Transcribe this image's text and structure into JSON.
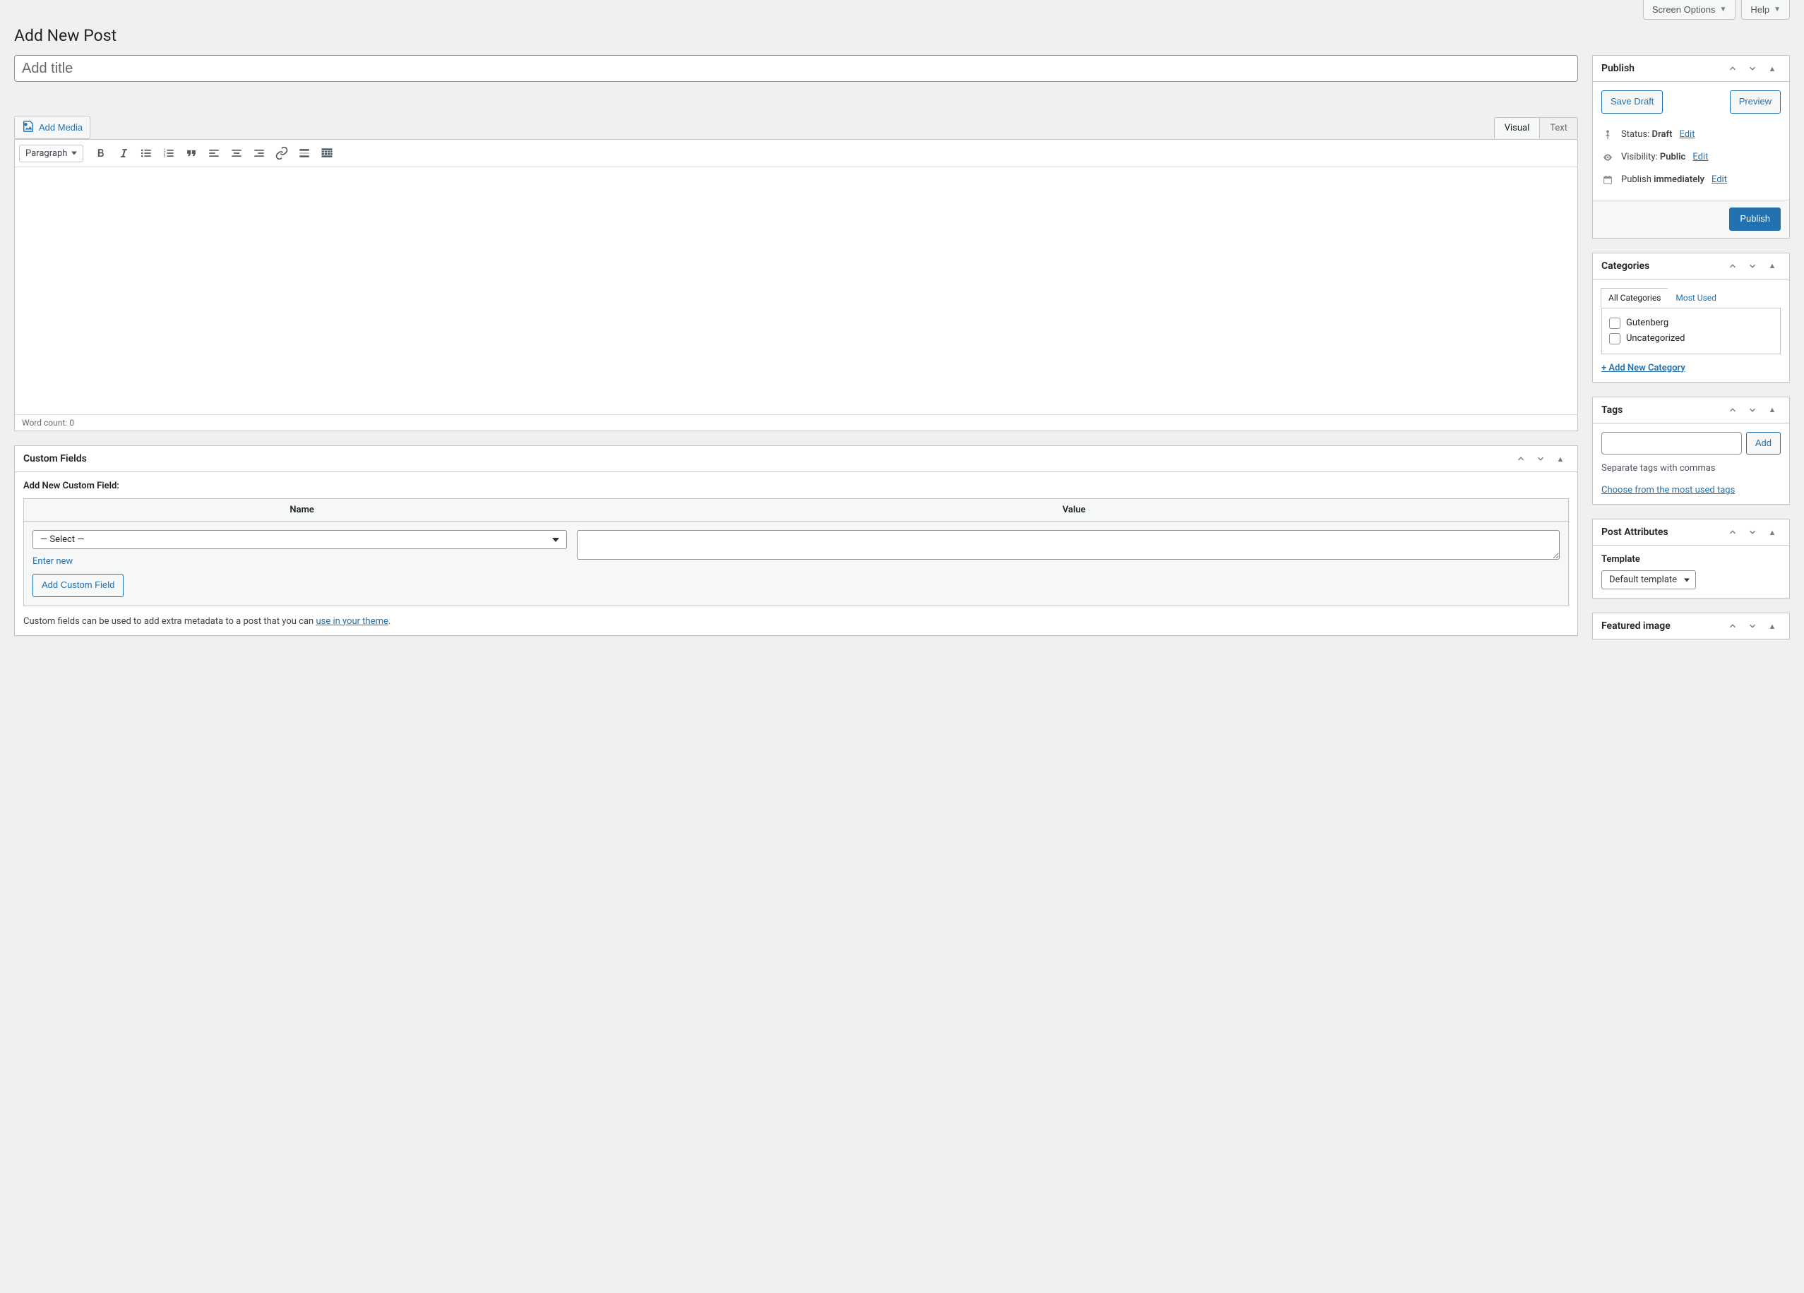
{
  "topbar": {
    "screen_options": "Screen Options",
    "help": "Help"
  },
  "page_title": "Add New Post",
  "title_input": {
    "value": "",
    "placeholder": "Add title"
  },
  "editor": {
    "add_media": "Add Media",
    "tab_visual": "Visual",
    "tab_text": "Text",
    "format_label": "Paragraph",
    "word_count_label": "Word count: ",
    "word_count_value": "0"
  },
  "publish": {
    "title": "Publish",
    "save_draft": "Save Draft",
    "preview": "Preview",
    "status_label": "Status: ",
    "status_value": "Draft",
    "visibility_label": "Visibility: ",
    "visibility_value": "Public",
    "schedule_label": "Publish ",
    "schedule_value": "immediately",
    "edit": "Edit",
    "publish_btn": "Publish"
  },
  "categories": {
    "title": "Categories",
    "tab_all": "All Categories",
    "tab_most_used": "Most Used",
    "items": [
      "Gutenberg",
      "Uncategorized"
    ],
    "add_new": "+ Add New Category"
  },
  "tags": {
    "title": "Tags",
    "add_btn": "Add",
    "desc": "Separate tags with commas",
    "choose_link": "Choose from the most used tags"
  },
  "post_attributes": {
    "title": "Post Attributes",
    "template_label": "Template",
    "template_value": "Default template"
  },
  "featured_image": {
    "title": "Featured image"
  },
  "custom_fields": {
    "title": "Custom Fields",
    "heading": "Add New Custom Field:",
    "col_name": "Name",
    "col_value": "Value",
    "select_placeholder": "— Select —",
    "enter_new": "Enter new",
    "add_btn": "Add Custom Field",
    "desc_prefix": "Custom fields can be used to add extra metadata to a post that you can ",
    "desc_link": "use in your theme",
    "desc_suffix": "."
  }
}
